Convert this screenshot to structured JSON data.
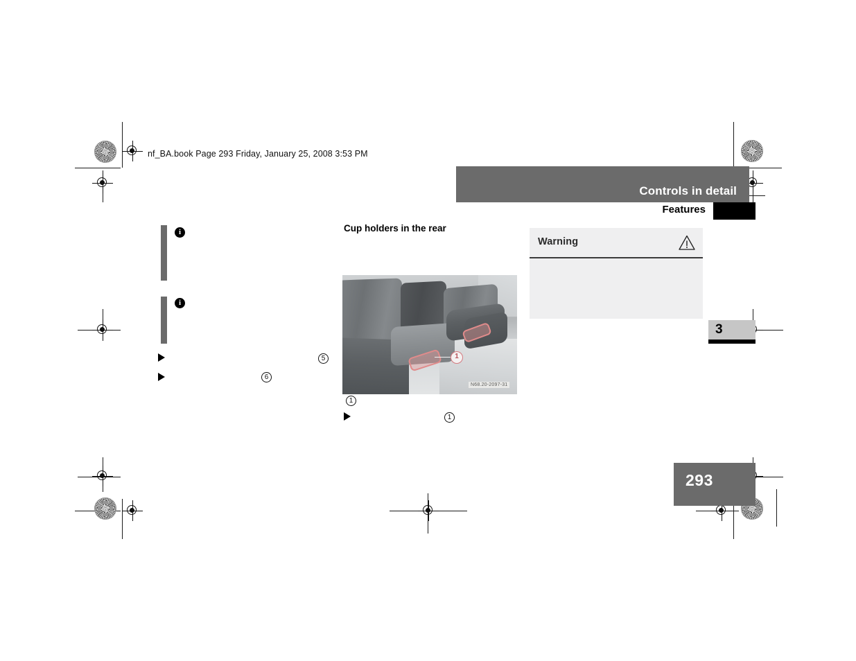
{
  "document": {
    "file_stamp": "nf_BA.book  Page 293  Friday, January 25, 2008  3:53 PM",
    "page_number": "293",
    "chapter_number": "3"
  },
  "header": {
    "band_title": "Controls in detail",
    "sub_title": "Features"
  },
  "left_column": {
    "info_icon_glyph": "i",
    "bullets": [
      "▶",
      "▶"
    ],
    "callout_refs": [
      "5",
      "6"
    ]
  },
  "middle_column": {
    "heading": "Cup holders in the rear",
    "figure": {
      "callout_label": "1",
      "image_code": "N68.20-2097-31",
      "caption_ref": "1",
      "step_bullet": "▶",
      "step_ref": "1"
    }
  },
  "right_column": {
    "warning": {
      "title": "Warning",
      "icon": "warning-triangle-icon",
      "body": ""
    }
  },
  "colors": {
    "header_gray": "#6b6b6b",
    "tab_gray": "#c6c6c6",
    "warn_bg": "#efeff0",
    "handle_highlight": "#e08b8b",
    "black": "#000000"
  }
}
